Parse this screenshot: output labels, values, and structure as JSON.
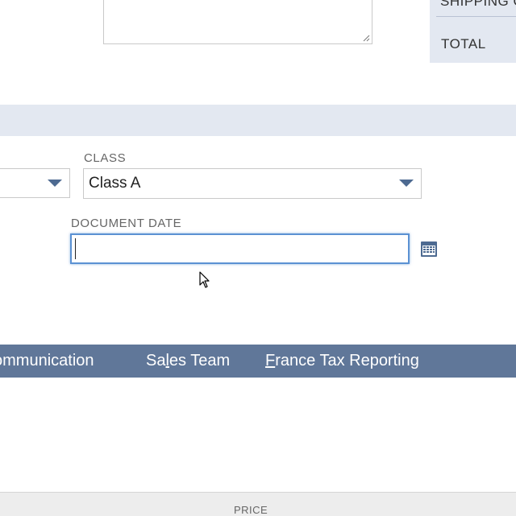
{
  "summary": {
    "shipping_label": "SHIPPING C",
    "total_label": "TOTAL"
  },
  "fields": {
    "class": {
      "label": "CLASS",
      "value": "Class A"
    },
    "document_date": {
      "label": "DOCUMENT DATE",
      "value": ""
    }
  },
  "tabs": [
    {
      "label_before": "ommunication",
      "accel": "",
      "label_after": ""
    },
    {
      "label_before": "Sa",
      "accel": "l",
      "label_after": "es Team"
    },
    {
      "label_before": "",
      "accel": "F",
      "label_after": "rance Tax Reporting"
    }
  ],
  "grid": {
    "price_header": "PRICE"
  },
  "colors": {
    "band": "#e3e8f1",
    "tabs_bar": "#607799",
    "focus_border": "#5b91d3",
    "caret": "#4d6a91"
  },
  "icons": [
    "calendar-icon",
    "chevron-down-icon",
    "mouse-pointer-icon",
    "resize-grip-icon"
  ]
}
